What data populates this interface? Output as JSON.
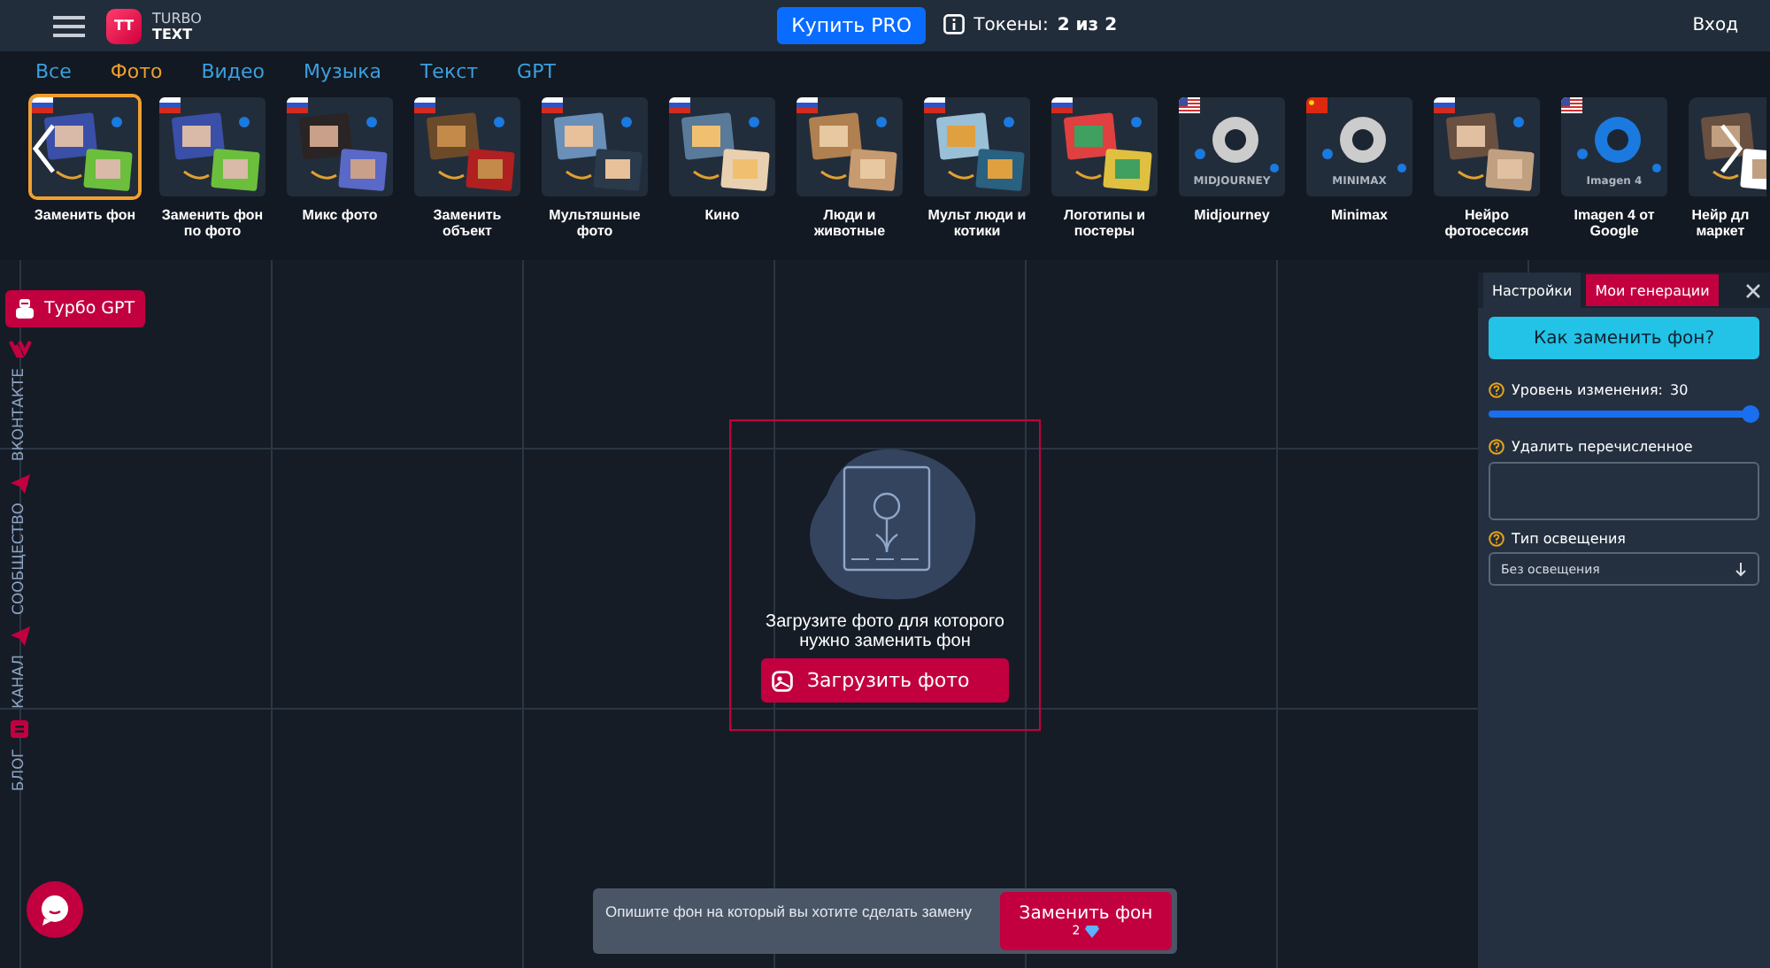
{
  "header": {
    "logo": {
      "mark": "TT",
      "line1": "TURBO",
      "line2": "TEXT"
    },
    "buy_button": "Купить PRO",
    "tokens_label": "Токены:",
    "tokens_value": "2 из 2",
    "login": "Вход"
  },
  "categories": [
    {
      "label": "Все",
      "selected": false
    },
    {
      "label": "Фото",
      "selected": true
    },
    {
      "label": "Видео",
      "selected": false
    },
    {
      "label": "Музыка",
      "selected": false
    },
    {
      "label": "Текст",
      "selected": false
    },
    {
      "label": "GPT",
      "selected": false
    }
  ],
  "tools": [
    {
      "label": "Заменить фон",
      "selected": true,
      "kind": "ru"
    },
    {
      "label": "Заменить фон по фото",
      "selected": false,
      "kind": "ru"
    },
    {
      "label": "Микс фото",
      "selected": false,
      "kind": "ru"
    },
    {
      "label": "Заменить объект",
      "selected": false,
      "kind": "ru"
    },
    {
      "label": "Мультяшные фото",
      "selected": false,
      "kind": "ru"
    },
    {
      "label": "Кино",
      "selected": false,
      "kind": "ru"
    },
    {
      "label": "Люди и животные",
      "selected": false,
      "kind": "ru"
    },
    {
      "label": "Мульт люди и котики",
      "selected": false,
      "kind": "ru"
    },
    {
      "label": "Логотипы и постеры",
      "selected": false,
      "kind": "ru"
    },
    {
      "label": "Midjourney",
      "selected": false,
      "kind": "us",
      "logo": "MIDJOURNEY"
    },
    {
      "label": "Minimax",
      "selected": false,
      "kind": "cn",
      "logo": "MINIMAX"
    },
    {
      "label": "Нейро фотосессия",
      "selected": false,
      "kind": "ru"
    },
    {
      "label": "Imagen 4 от Google",
      "selected": false,
      "kind": "us",
      "logo": "Imagen 4"
    },
    {
      "label": "Нейр дл маркет",
      "selected": false
    }
  ],
  "sidebar": {
    "gpt_button": "Турбо GPT",
    "links": [
      {
        "label": "ВКОНТАКТЕ",
        "kind": "vk"
      },
      {
        "label": "СООБЩЕСТВО",
        "kind": "telegram"
      },
      {
        "label": "КАНАЛ",
        "kind": "telegram"
      },
      {
        "label": "БЛОГ",
        "kind": "blog"
      }
    ]
  },
  "upload": {
    "hint": "Загрузите фото для которого нужно заменить фон",
    "button": "Загрузить фото"
  },
  "prompt": {
    "placeholder": "Опишите фон на который вы хотите сделать замену",
    "submit": "Заменить фон",
    "cost": "2"
  },
  "panel": {
    "tabs": [
      {
        "label": "Настройки",
        "selected": true
      },
      {
        "label": "Мои генерации",
        "selected": false
      }
    ],
    "help_button": "Как заменить фон?",
    "strength": {
      "label": "Уровень изменения:",
      "reading": "30",
      "level": 1.0
    },
    "remove": {
      "label": "Удалить перечисленное"
    },
    "lighting": {
      "label": "Тип освещения",
      "value": "Без освещения"
    }
  }
}
